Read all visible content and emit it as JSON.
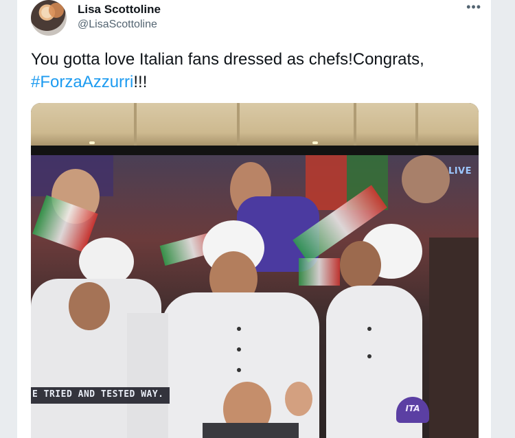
{
  "tweet": {
    "author_name": "Lisa Scottoline",
    "author_handle": "@LisaScottoline",
    "more_label": "•••",
    "text_main": "You gotta love Italian fans dressed as chefs!Congrats,",
    "hashtag": "#ForzaAzzurri",
    "text_end": "!!!"
  },
  "media": {
    "live_badge": "LIVE",
    "ticker_text": "E TRIED AND TESTED WAY.",
    "cap_text": "ITA"
  },
  "colors": {
    "hashtag": "#1d9bf0",
    "name": "#0f1419",
    "handle": "#536471"
  }
}
